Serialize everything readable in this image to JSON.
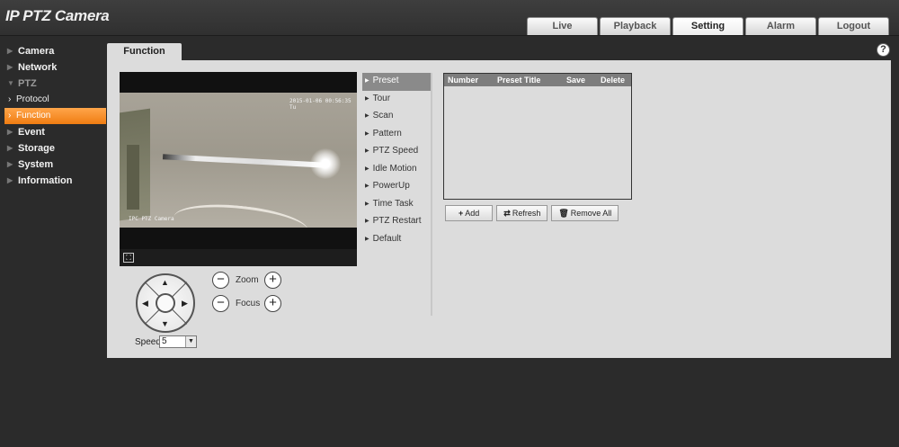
{
  "app": {
    "title": "IP PTZ Camera"
  },
  "topnav": {
    "tabs": [
      "Live",
      "Playback",
      "Setting",
      "Alarm",
      "Logout"
    ],
    "active": "Setting"
  },
  "sidebar": {
    "items": [
      {
        "label": "Camera"
      },
      {
        "label": "Network"
      },
      {
        "label": "PTZ"
      },
      {
        "label": "Protocol",
        "sub": true
      },
      {
        "label": "Function",
        "sub": true,
        "active": true
      },
      {
        "label": "Event"
      },
      {
        "label": "Storage"
      },
      {
        "label": "System"
      },
      {
        "label": "Information"
      }
    ]
  },
  "content": {
    "tab": "Function",
    "help": "?"
  },
  "video": {
    "timestamp": "2015-01-06 00:56:35 Tu",
    "camera_name": "IPC PTZ Camera"
  },
  "controls": {
    "zoom_label": "Zoom",
    "focus_label": "Focus",
    "speed_label": "Speed",
    "speed_value": "5"
  },
  "function_menu": [
    "Preset",
    "Tour",
    "Scan",
    "Pattern",
    "PTZ Speed",
    "Idle Motion",
    "PowerUp",
    "Time Task",
    "PTZ Restart",
    "Default"
  ],
  "preset_table": {
    "columns": [
      "Number",
      "Preset Title",
      "Save",
      "Delete"
    ],
    "rows": []
  },
  "buttons": {
    "add": "Add",
    "refresh": "Refresh",
    "remove_all": "Remove All"
  },
  "colors": {
    "accent": "#f08a1e",
    "panel_bg": "#dcdcdc",
    "page_bg": "#2b2b2b"
  }
}
